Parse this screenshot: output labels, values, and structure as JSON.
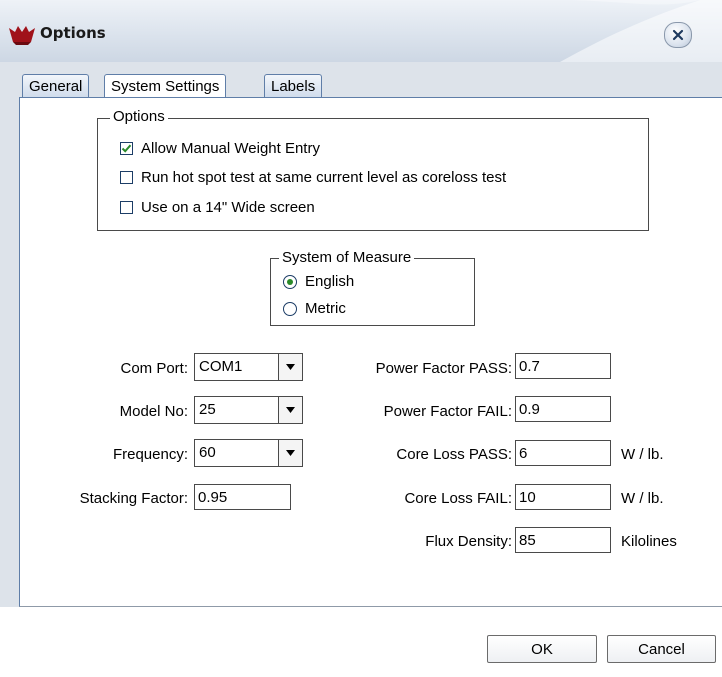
{
  "window": {
    "title": "Options"
  },
  "tabs": [
    {
      "label": "General"
    },
    {
      "label": "System Settings"
    },
    {
      "label": "Labels"
    }
  ],
  "options_group": {
    "legend": "Options",
    "items": [
      {
        "label": "Allow Manual Weight Entry",
        "checked": true
      },
      {
        "label": "Run hot spot test at same current level as coreloss test",
        "checked": false
      },
      {
        "label": "Use on a 14\" Wide screen",
        "checked": false
      }
    ]
  },
  "measure_group": {
    "legend": "System of Measure",
    "options": [
      {
        "label": "English",
        "selected": true
      },
      {
        "label": "Metric",
        "selected": false
      }
    ]
  },
  "left_fields": {
    "com_port": {
      "label": "Com Port:",
      "value": "COM1"
    },
    "model_no": {
      "label": "Model No:",
      "value": "25"
    },
    "frequency": {
      "label": "Frequency:",
      "value": "60"
    },
    "stacking_factor": {
      "label": "Stacking Factor:",
      "value": "0.95"
    }
  },
  "right_fields": {
    "pf_pass": {
      "label": "Power Factor PASS:",
      "value": "0.7",
      "unit": ""
    },
    "pf_fail": {
      "label": "Power Factor FAIL:",
      "value": "0.9",
      "unit": ""
    },
    "cl_pass": {
      "label": "Core Loss PASS:",
      "value": "6",
      "unit": "W / lb."
    },
    "cl_fail": {
      "label": "Core Loss FAIL:",
      "value": "10",
      "unit": "W / lb."
    },
    "flux": {
      "label": "Flux Density:",
      "value": "85",
      "unit": "Kilolines"
    }
  },
  "buttons": {
    "ok": "OK",
    "cancel": "Cancel"
  },
  "colors": {
    "accent": "#5f7ea8",
    "check": "#2a8a2a",
    "logo": "#a0121a"
  }
}
